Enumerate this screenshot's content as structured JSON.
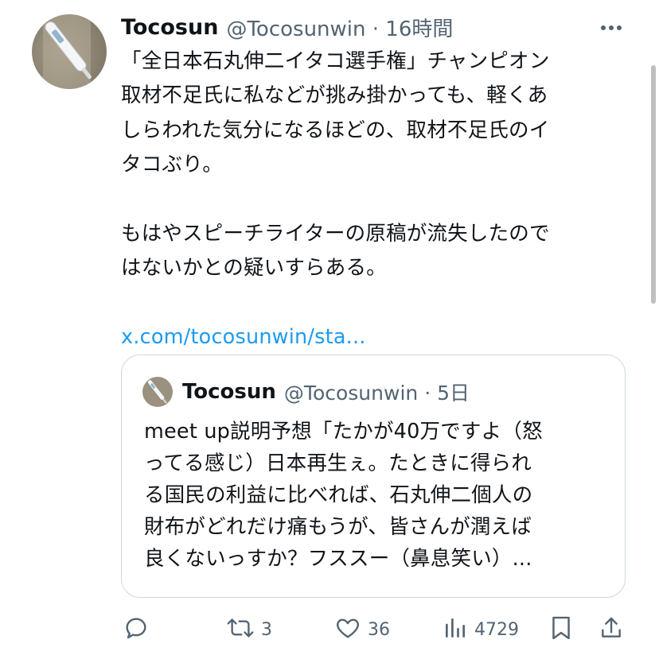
{
  "tweet": {
    "author_name": "Tocosun",
    "author_handle": "@Tocosunwin",
    "separator": "·",
    "time": "16時間",
    "lines": [
      "「全日本石丸伸二イタコ選手権」チャンピオン",
      "取材不足氏に私などが挑み掛かっても、軽くあ",
      "しらわれた気分になるほどの、取材不足氏のイ",
      "タコぶり。",
      "",
      "もはやスピーチライターの原稿が流失したので",
      "はないかとの疑いすらある。",
      ""
    ],
    "link": "x.com/tocosunwin/sta..."
  },
  "quote": {
    "author_name": "Tocosun",
    "author_handle": "@Tocosunwin",
    "separator": "·",
    "time": "5日",
    "lines": [
      "meet up説明予想「たかが40万ですよ（怒",
      "ってる感じ）日本再生ぇ。たときに得られ",
      "る国民の利益に比べれば、石丸伸二個人の",
      "財布がどれだけ痛もうが、皆さんが潤えば",
      "良くないっすか？フススー（鼻息笑い）..."
    ]
  },
  "actions": {
    "reply_icon": "reply-icon",
    "retweet_icon": "retweet-icon",
    "retweet_count": "3",
    "like_icon": "heart-icon",
    "like_count": "36",
    "views_icon": "views-icon",
    "views_count": "4729",
    "bookmark_icon": "bookmark-icon",
    "share_icon": "share-icon"
  },
  "colors": {
    "text": "#0f1419",
    "secondary": "#536471",
    "link": "#1d9bf0",
    "border": "#cfd9de"
  }
}
